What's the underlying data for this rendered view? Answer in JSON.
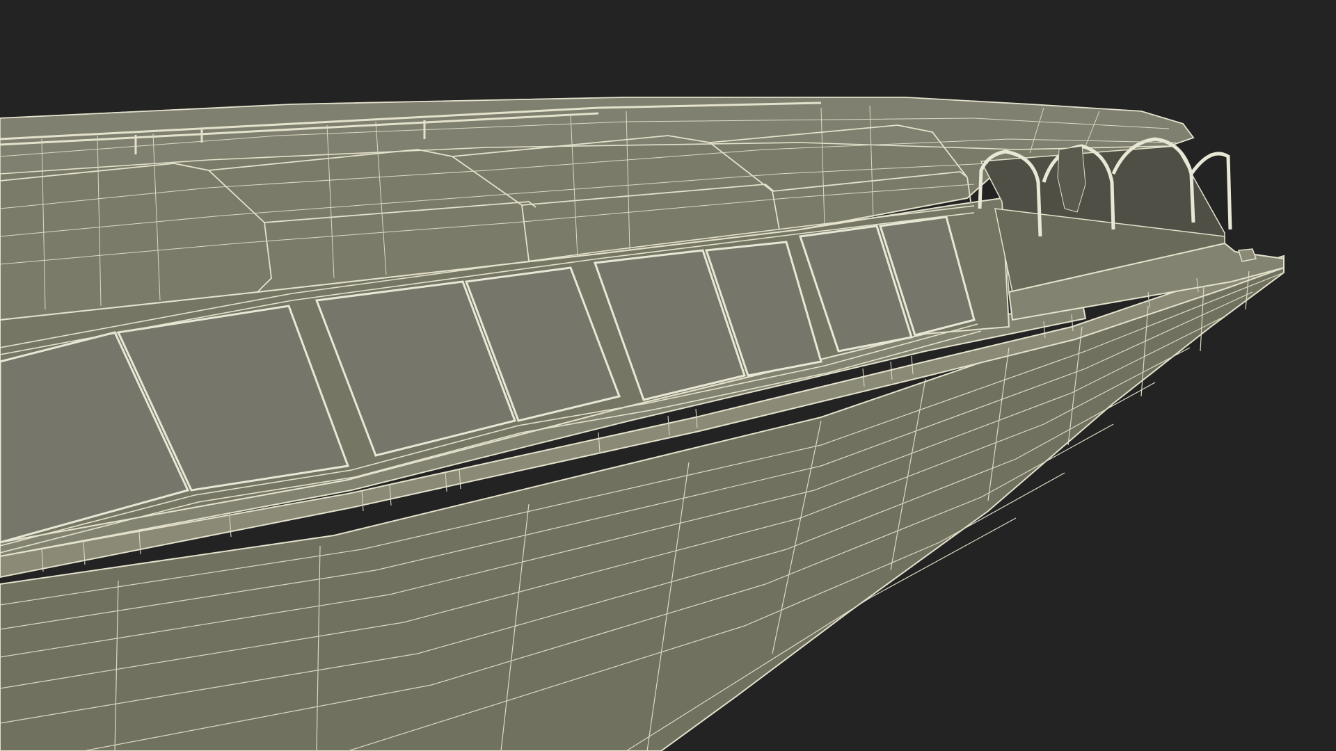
{
  "scene": {
    "subject": "boat-hull-wireframe-render",
    "colors": {
      "background": "#232323",
      "hull_fill": "#767664",
      "hull_fill_light": "#7d7d6b",
      "hull_fill_dark": "#6a6a5a",
      "window_glass": "#77776a",
      "window_frame": "#e9e8d6",
      "wire": "#e4e2cc",
      "wire_faint": "#cfcdb6",
      "canopy_interior": "#4f4f45"
    }
  }
}
